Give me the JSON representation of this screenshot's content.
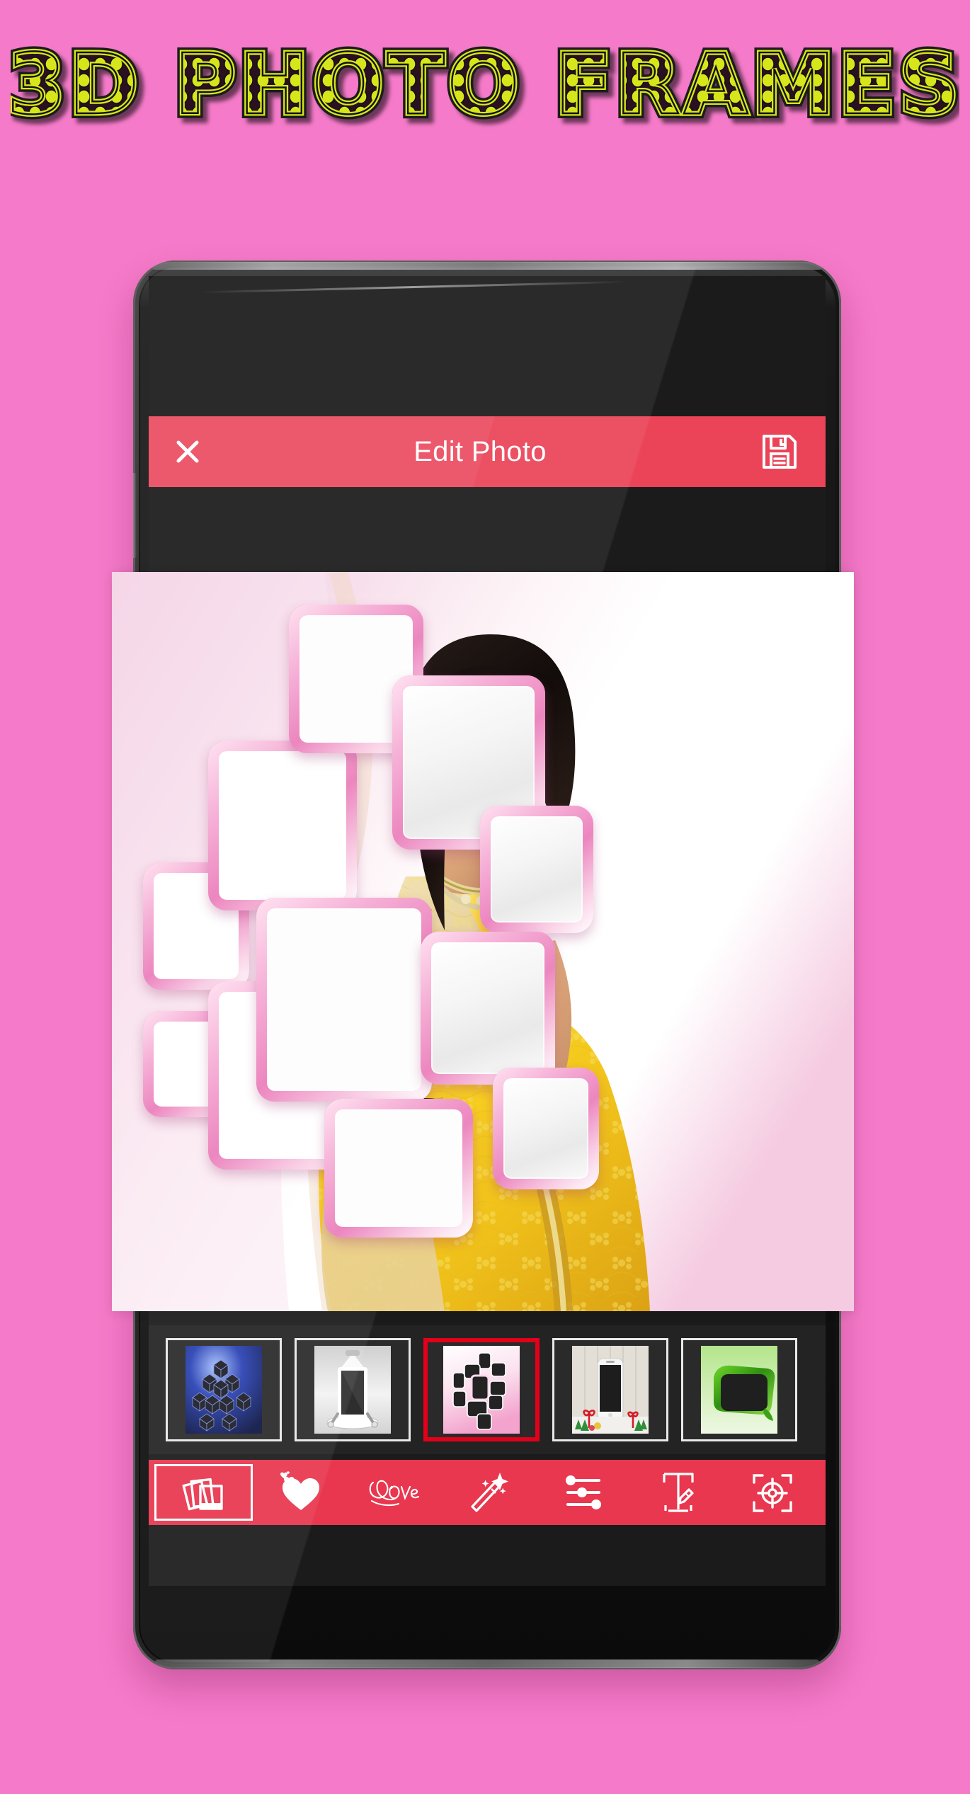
{
  "page": {
    "background_color": "#F57AC9",
    "title": "3D PHOTO FRAMES"
  },
  "header_banner": {
    "text": "3D PHOTO FRAMES",
    "fill_color": "#D7E61B",
    "outline_color": "#000000",
    "style": "marquee-bulb-letters"
  },
  "device": {
    "name": "android-phone-mockup",
    "body_color": "#141414",
    "front_camera": "front-camera",
    "earpiece": "earpiece-speaker",
    "bottom_speaker": "bottom-speaker-grille"
  },
  "app": {
    "topbar": {
      "close_label": "✕",
      "title": "Edit Photo",
      "save_icon": "save-floppy-icon",
      "background_color": "#EB4358",
      "text_color": "#FFFFFF"
    },
    "canvas": {
      "name": "photo-edit-canvas",
      "frame_template": "pink-3d-collage",
      "subject": "woman-in-yellow-saree",
      "frame_color": "#F3A0CB",
      "background_gradient": "pink-to-white"
    },
    "frame_picker": {
      "name": "frame-thumbnail-strip",
      "selected_index": 2,
      "selection_color": "#E2001A",
      "items": [
        {
          "id": "frame-blue-cubes",
          "label": "Blue 3D Cubes",
          "accent": "#2a49c8"
        },
        {
          "id": "frame-grey-stage",
          "label": "Grey Stage Spotlight",
          "accent": "#b9b9b9"
        },
        {
          "id": "frame-pink-collage",
          "label": "Pink Collage",
          "accent": "#f3a0cb"
        },
        {
          "id": "frame-xmas-wood",
          "label": "Christmas Wood",
          "accent": "#c9c3b8"
        },
        {
          "id": "frame-green-ribbon",
          "label": "Green Ribbon",
          "accent": "#49c02a"
        }
      ]
    },
    "toolbar": {
      "name": "editor-toolbar",
      "background_color": "#E8374F",
      "active_index": 0,
      "items": [
        {
          "id": "tool-frames",
          "label": "Frames",
          "icon": "photos-stack-icon"
        },
        {
          "id": "tool-stickers",
          "label": "Stickers",
          "icon": "hearts-icon"
        },
        {
          "id": "tool-love-text",
          "label": "Love",
          "icon": "love-script-icon"
        },
        {
          "id": "tool-effects",
          "label": "Effects",
          "icon": "magic-wand-icon"
        },
        {
          "id": "tool-adjust",
          "label": "Adjust",
          "icon": "sliders-icon"
        },
        {
          "id": "tool-text",
          "label": "Text",
          "icon": "text-pen-icon"
        },
        {
          "id": "tool-crop",
          "label": "Crop",
          "icon": "focus-target-icon"
        }
      ]
    }
  }
}
